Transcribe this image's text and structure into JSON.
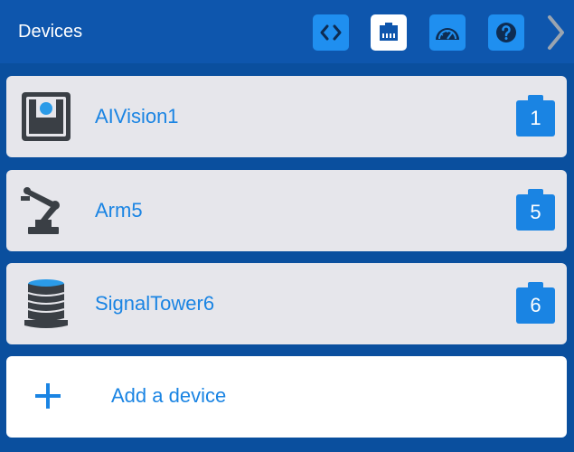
{
  "header": {
    "title": "Devices",
    "buttons": [
      {
        "name": "code-icon",
        "active": false
      },
      {
        "name": "ports-icon",
        "active": true
      },
      {
        "name": "dashboard-icon",
        "active": false
      },
      {
        "name": "help-icon",
        "active": false
      }
    ],
    "next_icon": "chevron-right-icon"
  },
  "devices": [
    {
      "name": "AIVision1",
      "port": "1",
      "icon": "ai-vision-icon"
    },
    {
      "name": "Arm5",
      "port": "5",
      "icon": "robot-arm-icon"
    },
    {
      "name": "SignalTower6",
      "port": "6",
      "icon": "signal-tower-icon"
    }
  ],
  "add_device": {
    "label": "Add a device",
    "icon": "plus-icon"
  },
  "colors": {
    "header": "#0e56ad",
    "background": "#0a4f9e",
    "accent": "#1a84e3",
    "card": "#e6e6eb",
    "icon_dark": "#3a3f45"
  }
}
